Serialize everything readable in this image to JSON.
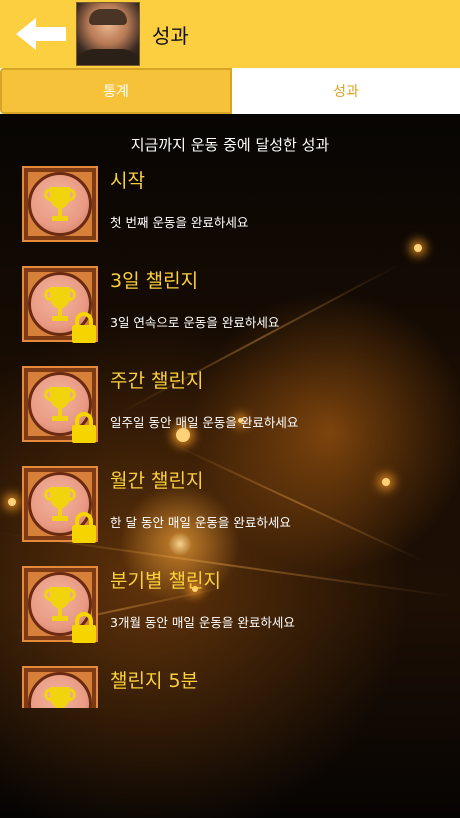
{
  "header": {
    "title": "성과"
  },
  "tabs": [
    {
      "label": "통계",
      "active": true
    },
    {
      "label": "성과",
      "active": false
    }
  ],
  "subtitle": "지금까지 운동 중에 달성한 성과",
  "achievements": [
    {
      "name": "시작",
      "desc": "첫 번째 운동을 완료하세요",
      "locked": false
    },
    {
      "name": "3일 챌린지",
      "desc": "3일 연속으로 운동을 완료하세요",
      "locked": true
    },
    {
      "name": "주간 챌린지",
      "desc": "일주일 동안 매일 운동을 완료하세요",
      "locked": true
    },
    {
      "name": "월간 챌린지",
      "desc": "한 달 동안 매일 운동을 완료하세요",
      "locked": true
    },
    {
      "name": "분기별 챌린지",
      "desc": "3개월 동안 매일 운동을 완료하세요",
      "locked": true
    },
    {
      "name": "챌린지 5분",
      "desc": "",
      "locked": true
    }
  ],
  "colors": {
    "header_bg": "#fbcf3f",
    "accent": "#f6c23a",
    "achievement_title": "#fbd13b"
  },
  "icons": {
    "back": "left-arrow-icon",
    "trophy": "trophy-icon",
    "lock": "lock-icon"
  }
}
